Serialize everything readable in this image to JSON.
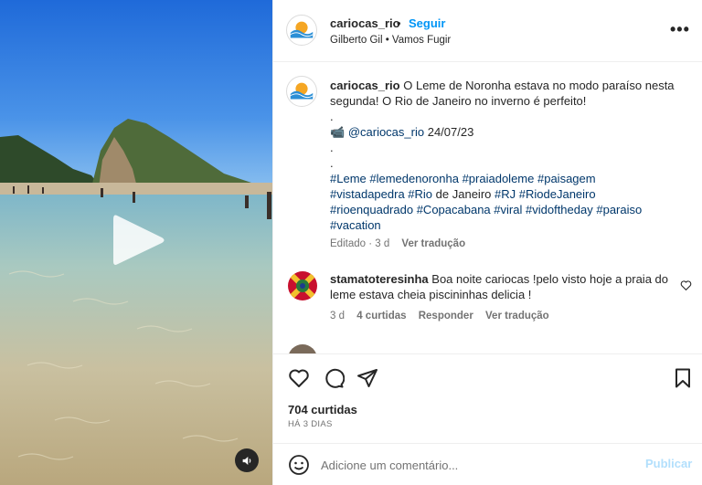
{
  "header": {
    "username": "cariocas_rio",
    "separator": "•",
    "follow_label": "Seguir",
    "audio_info": "Gilberto Gil • Vamos Fugir",
    "more_label": "•••"
  },
  "caption": {
    "username": "cariocas_rio",
    "text_1": "O Leme de Noronha estava no modo paraíso nesta segunda! O Rio de Janeiro no inverno é perfeito!",
    "dot_1": ".",
    "camera_emoji": "📹",
    "credit_mention": "@cariocas_rio",
    "credit_date": "24/07/23",
    "dot_2": ".",
    "dot_3": ".",
    "tags_line1": [
      "#Leme",
      "#lemedenoronha",
      "#praiadoleme",
      "#paisagem"
    ],
    "tags_line2_a": "#vistadapedra",
    "tags_line2_b": "#Rio",
    "tags_line2_plain": "de Janeiro",
    "tags_line2_c": [
      "#RJ",
      "#RiodeJaneiro"
    ],
    "tags_line3": [
      "#rioenquadrado",
      "#Copacabana",
      "#viral",
      "#vidoftheday",
      "#paraiso"
    ],
    "tags_line4": [
      "#vacation"
    ],
    "edited": "Editado · 3 d",
    "see_translation": "Ver tradução"
  },
  "comments": [
    {
      "username": "stamatoteresinha",
      "text": "Boa noite cariocas !pelo visto hoje a praia do leme estava cheia piscininhas delicia !",
      "time": "3 d",
      "likes": "4 curtidas",
      "reply": "Responder",
      "see_translation": "Ver tradução"
    },
    {
      "username": "",
      "text": ""
    }
  ],
  "actions": {
    "likes": "704 curtidas",
    "time": "HÁ 3 DIAS"
  },
  "composer": {
    "placeholder": "Adicione um comentário...",
    "publish": "Publicar"
  },
  "colors": {
    "accent": "#0095f6",
    "hashtag": "#00376b",
    "muted": "#737373",
    "publish_disabled": "#b2dffc"
  }
}
